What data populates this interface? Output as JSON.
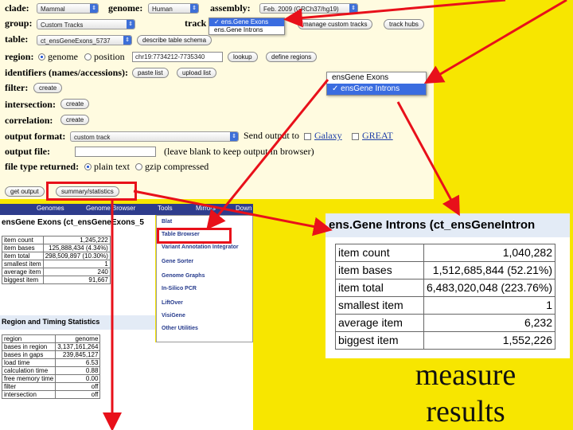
{
  "form": {
    "clade_label": "clade:",
    "clade_value": "Mammal",
    "genome_label": "genome:",
    "genome_value": "Human",
    "assembly_label": "assembly:",
    "assembly_value": "Feb. 2009 (GRCh37/hg19)",
    "group_label": "group:",
    "group_value": "Custom Tracks",
    "track_label": "track",
    "track_menu": [
      "✓ ens.Gene Exons",
      "ens.Gene Introns"
    ],
    "manage_custom_tracks": "manage custom tracks",
    "track_hubs": "track hubs",
    "table_label": "table:",
    "table_value": "ct_ensGeneExons_5737",
    "describe_table_schema": "describe table schema",
    "region_label": "region:",
    "region_genome": "genome",
    "region_position": "position",
    "position_value": "chr19:7734212-7735340",
    "lookup": "lookup",
    "define_regions": "define regions",
    "identifiers_label": "identifiers (names/accessions):",
    "paste_list": "paste list",
    "upload_list": "upload list",
    "filter_label": "filter:",
    "create": "create",
    "intersection_label": "intersection:",
    "correlation_label": "correlation:",
    "output_format_label": "output format:",
    "output_format_value": "custom track",
    "send_output_to": "Send output to",
    "galaxy": "Galaxy",
    "great": "GREAT",
    "output_file_label": "output file:",
    "output_file_hint": "(leave blank to keep output in browser)",
    "file_type_label": "file type returned:",
    "plain_text": "plain text",
    "gzip": "gzip compressed",
    "get_output": "get output",
    "summary_statistics": "summary/statistics"
  },
  "track_popup": [
    "ensGene Exons",
    "✓ ensGene Introns"
  ],
  "navbar": [
    "Genomes",
    "Genome Browser",
    "Tools",
    "Mirrors",
    "Down"
  ],
  "exons": {
    "title": "ensGene Exons (ct_ensGeneExons_5",
    "rows": [
      [
        "item count",
        "1,245,222"
      ],
      [
        "item bases",
        "125,888,434 (4.34%)"
      ],
      [
        "item total",
        "298,509,897 (10.30%)"
      ],
      [
        "smallest item",
        "1"
      ],
      [
        "average item",
        "240"
      ],
      [
        "biggest item",
        "91,667"
      ]
    ]
  },
  "timing": {
    "title": "Region and Timing Statistics",
    "rows": [
      [
        "region",
        "genome"
      ],
      [
        "bases in region",
        "3,137,161,264"
      ],
      [
        "bases in gaps",
        "239,845,127"
      ],
      [
        "load time",
        "6.53"
      ],
      [
        "calculation time",
        "0.88"
      ],
      [
        "free memory time",
        "0.00"
      ],
      [
        "filter",
        "off"
      ],
      [
        "intersection",
        "off"
      ]
    ]
  },
  "tools_menu": [
    "Blat",
    "Table Browser",
    "Variant Annotation Integrator",
    "Gene Sorter",
    "Genome Graphs",
    "In-Silico PCR",
    "LiftOver",
    "VisiGene",
    "Other Utilities"
  ],
  "introns": {
    "title": "ens.Gene Introns (ct_ensGeneIntron",
    "rows": [
      [
        "item count",
        "1,040,282"
      ],
      [
        "item bases",
        "1,512,685,844 (52.21%)"
      ],
      [
        "item total",
        "6,483,020,048 (223.76%)"
      ],
      [
        "smallest item",
        "1"
      ],
      [
        "average item",
        "6,232"
      ],
      [
        "biggest item",
        "1,552,226"
      ]
    ]
  },
  "caption": [
    "measure",
    "results"
  ],
  "colors": {
    "background": "#f7e600",
    "highlight": "#e8101a",
    "menu_select": "#3a6ce0"
  }
}
